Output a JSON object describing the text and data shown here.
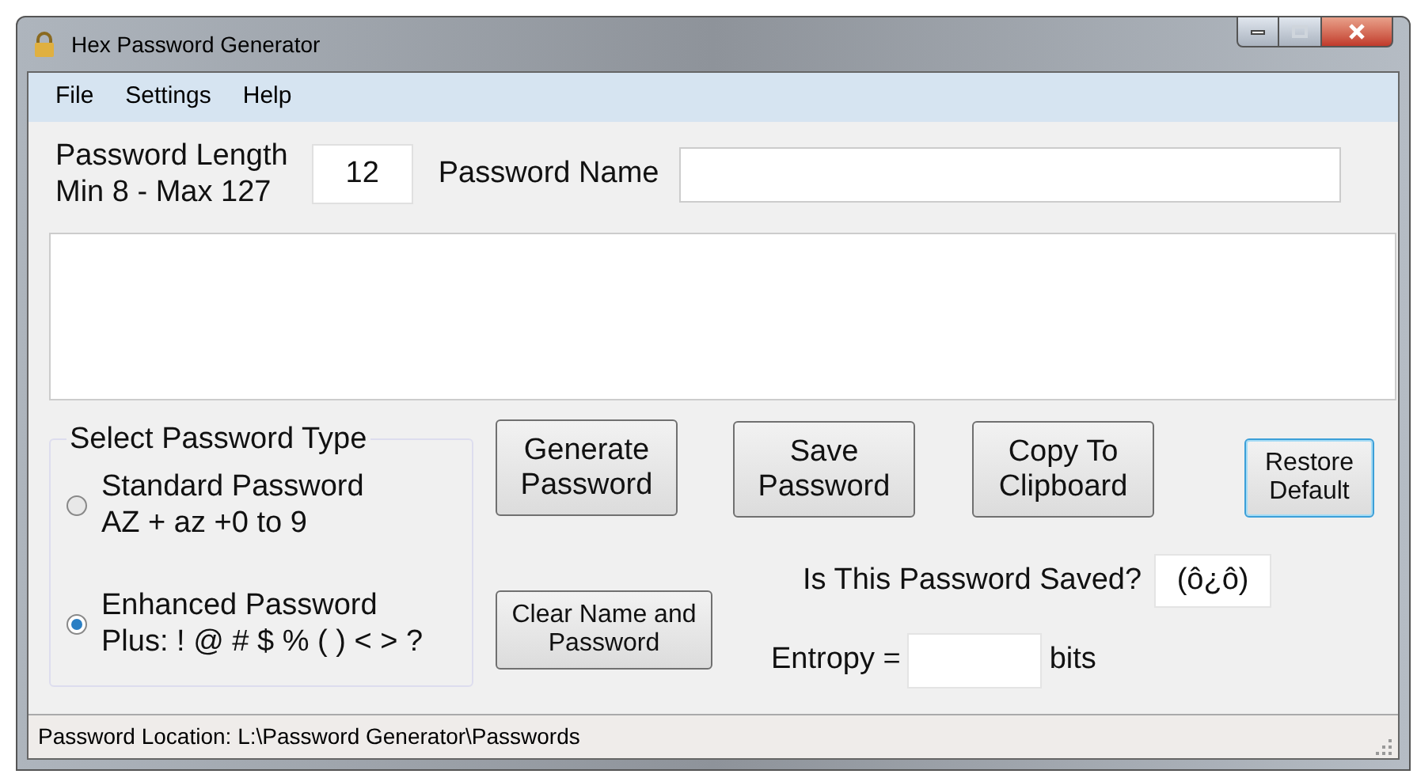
{
  "window": {
    "title": "Hex Password Generator"
  },
  "menu": [
    "File",
    "Settings",
    "Help"
  ],
  "length": {
    "label": [
      "Password Length",
      "Min 8 - Max 127"
    ],
    "value": "12"
  },
  "name_field": {
    "label": "Password Name"
  },
  "password_type": {
    "title": "Select Password Type",
    "options": [
      {
        "lines": [
          "Standard Password",
          "AZ + az +0 to 9"
        ],
        "selected": false
      },
      {
        "lines": [
          "Enhanced Password",
          "Plus: ! @ # $ % ( ) < > ?"
        ],
        "selected": true
      }
    ]
  },
  "buttons": {
    "generate": "Generate Password",
    "clear": "Clear Name and Password",
    "save": "Save Password",
    "copy": "Copy To Clipboard",
    "restore": "Restore Default"
  },
  "saved": {
    "label": "Is This Password Saved?",
    "value": "(ô¿ô)"
  },
  "entropy": {
    "label": "Entropy =",
    "unit": "bits"
  },
  "status_bar": "Password Location: L:\\Password Generator\\Passwords"
}
